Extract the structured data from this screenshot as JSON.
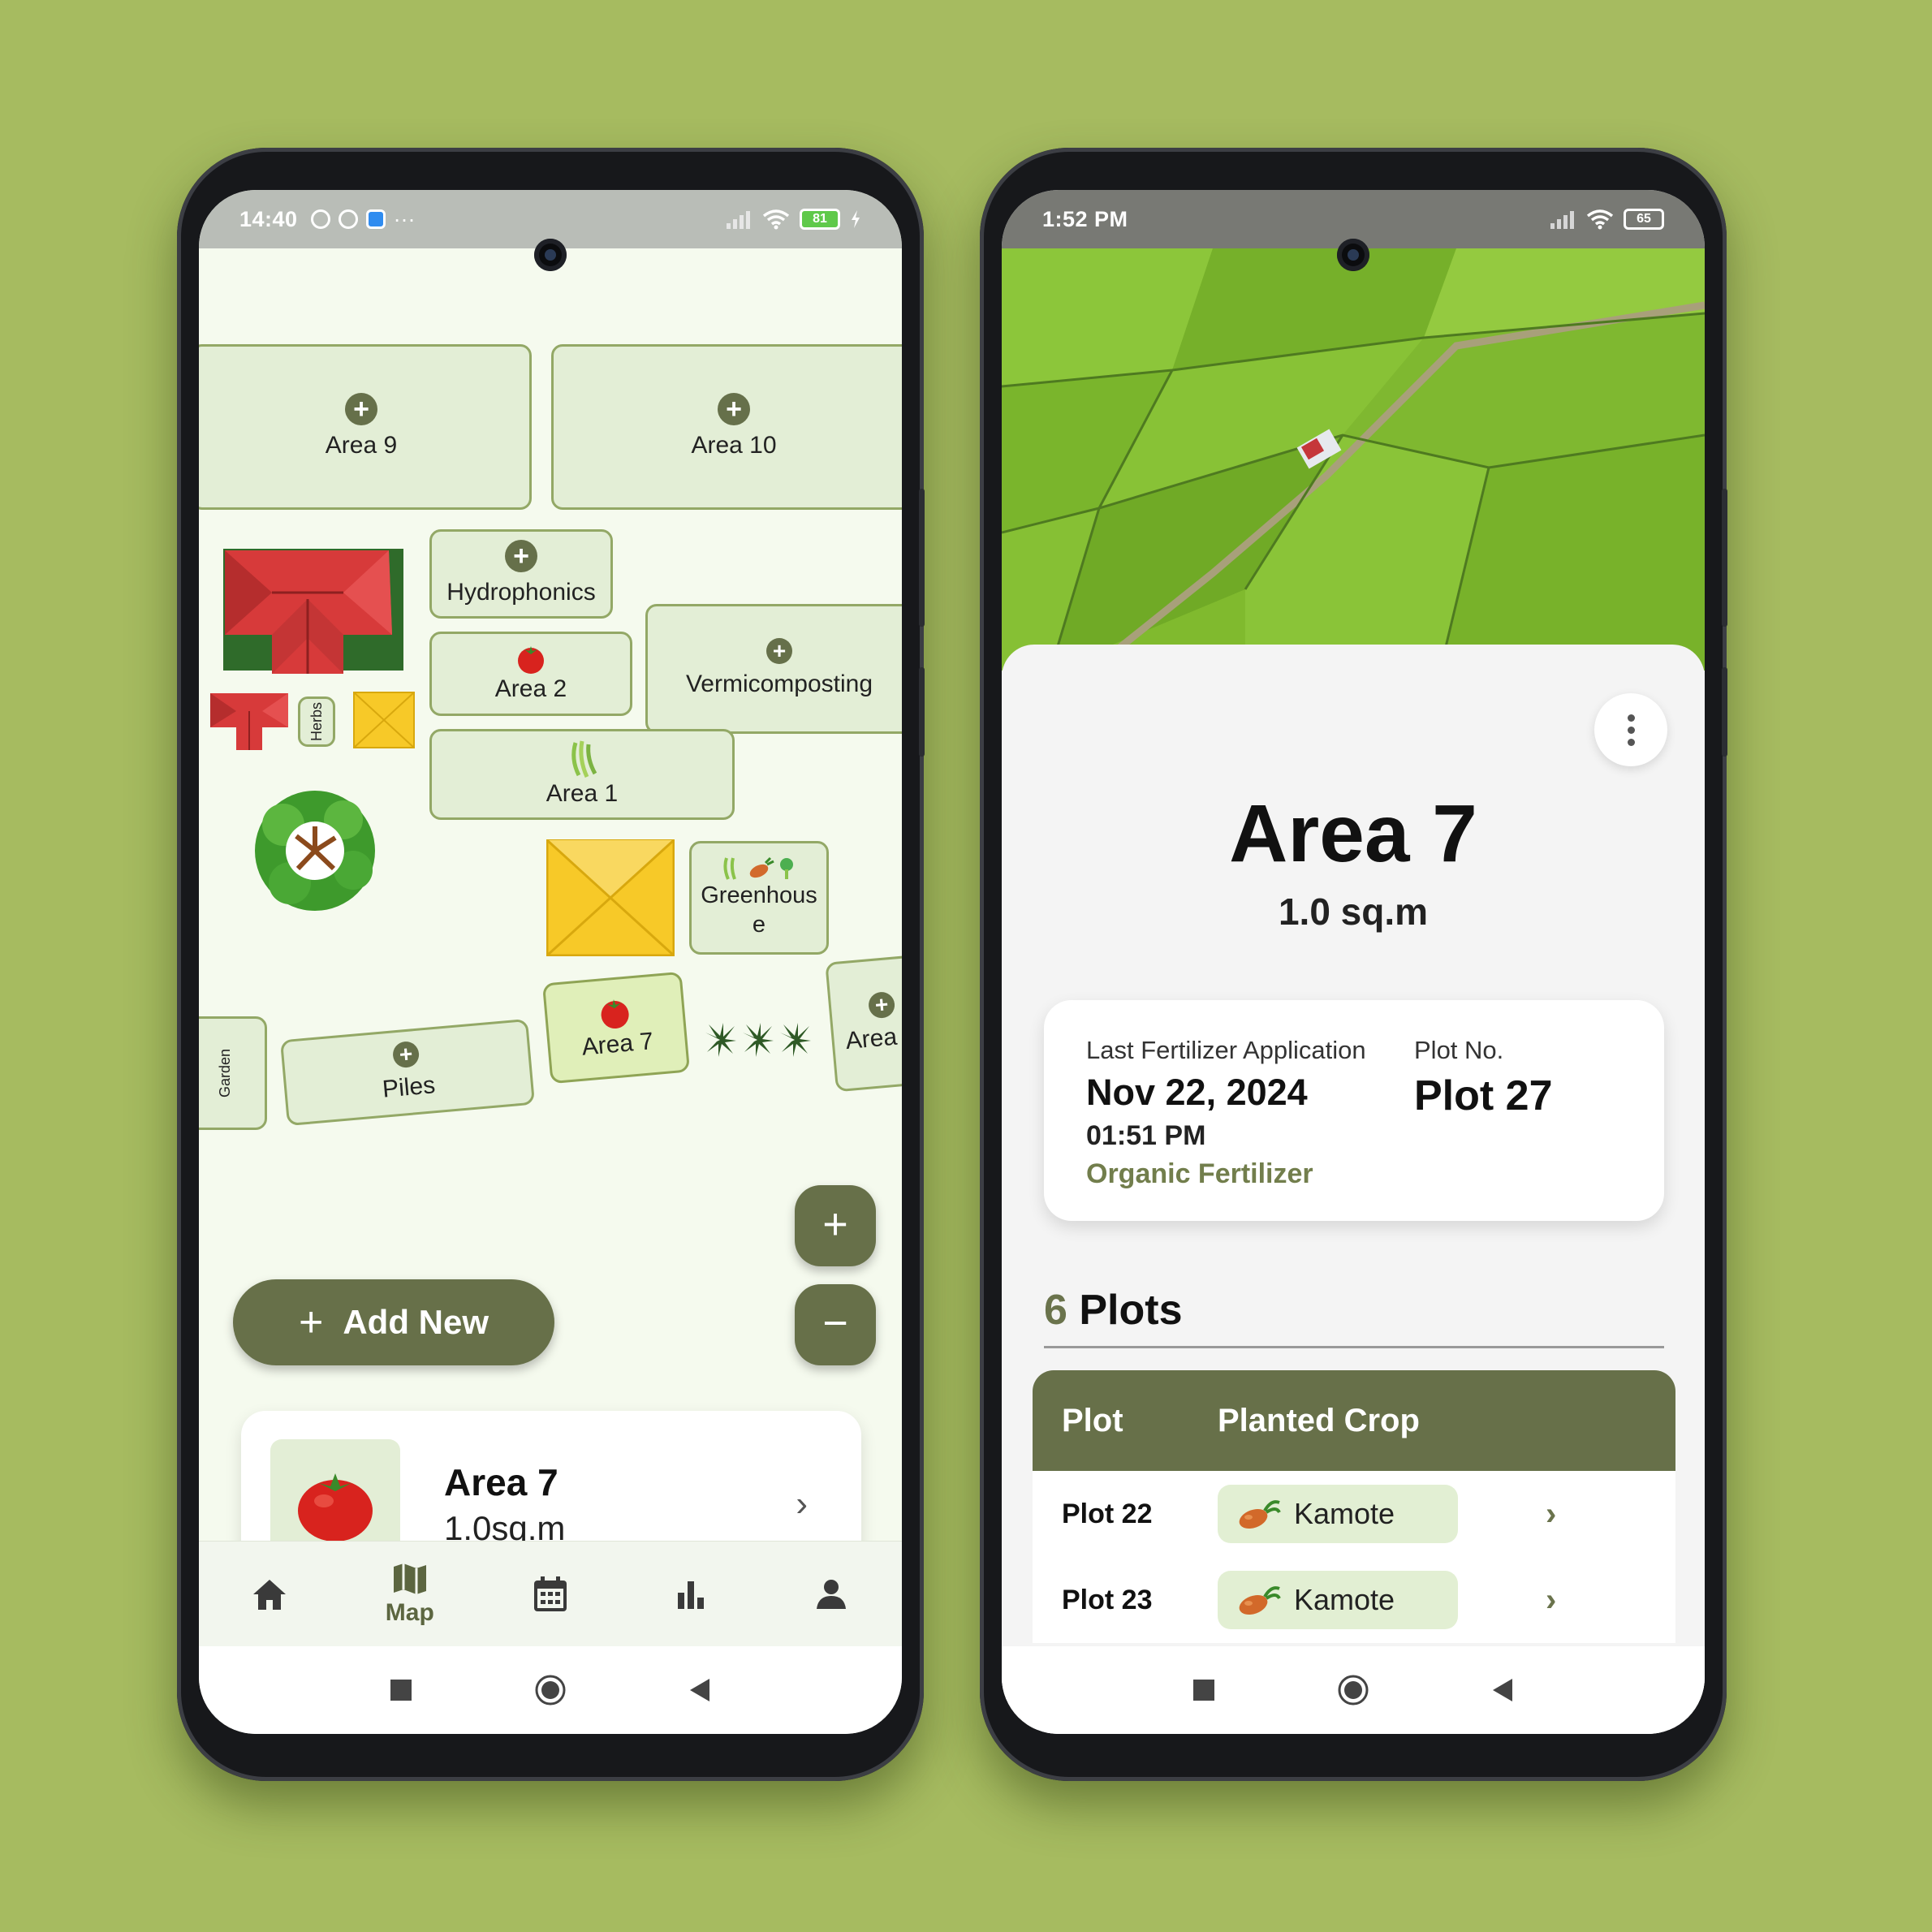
{
  "left_phone": {
    "status": {
      "time": "14:40",
      "battery": "81",
      "more": "···"
    },
    "map": {
      "areas": {
        "area9": "Area 9",
        "area10": "Area 10",
        "hydrophonics": "Hydrophonics",
        "vermicomposting": "Vermicomposting",
        "area2": "Area 2",
        "area1": "Area 1",
        "herbs": "Herbs",
        "greenhouse_line1": "Greenhous",
        "greenhouse_line2": "e",
        "garden": "Garden",
        "piles": "Piles",
        "area7": "Area 7",
        "area_partial": "Area"
      },
      "zoom_in": "+",
      "zoom_out": "−"
    },
    "add_new": {
      "icon": "+",
      "label": "Add New"
    },
    "selected_card": {
      "title": "Area 7",
      "size": "1.0sq.m",
      "icon": "tomato-icon"
    },
    "bottom_nav": [
      {
        "icon": "home-icon",
        "label": ""
      },
      {
        "icon": "map-icon",
        "label": "Map"
      },
      {
        "icon": "calendar-icon",
        "label": ""
      },
      {
        "icon": "bar-chart-icon",
        "label": ""
      },
      {
        "icon": "person-icon",
        "label": ""
      }
    ]
  },
  "right_phone": {
    "status": {
      "time": "1:52 PM",
      "battery": "65"
    },
    "detail": {
      "title": "Area 7",
      "size": "1.0 sq.m",
      "last_fertilizer_label": "Last Fertilizer Application",
      "last_fertilizer_date": "Nov 22, 2024",
      "last_fertilizer_time": "01:51 PM",
      "fertilizer_type": "Organic Fertilizer",
      "plot_no_label": "Plot No.",
      "plot_no_value": "Plot 27"
    },
    "plots": {
      "count": "6",
      "label": "Plots",
      "headers": {
        "plot": "Plot",
        "crop": "Planted Crop"
      },
      "rows": [
        {
          "plot": "Plot 22",
          "crop": "Kamote"
        },
        {
          "plot": "Plot 23",
          "crop": "Kamote"
        }
      ]
    }
  },
  "colors": {
    "background": "#a6bb60",
    "primary": "#677049",
    "plot_fill": "#e3eed6",
    "accent_text": "#727e4c"
  }
}
